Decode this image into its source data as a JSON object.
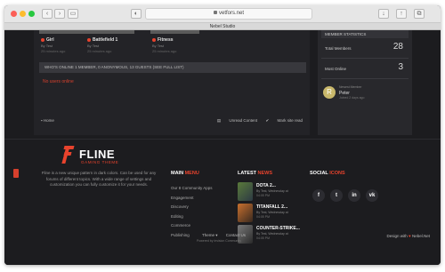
{
  "browser": {
    "url": "vetfors.net",
    "tab_title": "Nebel Studio"
  },
  "cards": [
    {
      "name": "Girl",
      "sub": "By Test",
      "time": "25 minutes ago"
    },
    {
      "name": "Battlefield 1",
      "sub": "By Test",
      "time": "25 minutes ago"
    },
    {
      "name": "Fitness",
      "sub": "By Test",
      "time": "25 minutes ago"
    }
  ],
  "whos_online": "WHO'S ONLINE   1 MEMBER, 0 ANONYMOUS, 13 GUESTS (SEE FULL LIST)",
  "no_users": "No users online",
  "home_link": "Home",
  "bottom_links": [
    "Unread Content",
    "Mark site read"
  ],
  "stats": {
    "header": "MEMBER STATISTICS",
    "rows": [
      {
        "label": "Total Members",
        "value": "28",
        "unit": ""
      },
      {
        "label": "Most Online",
        "value": "3",
        "unit": ""
      }
    ],
    "newest": {
      "label": "Newest Member",
      "name": "Peter",
      "meta": "Joined 2 days ago"
    }
  },
  "brand": {
    "name": "FLINE",
    "tagline": "GAMING THEME",
    "description": "Fline is a new unique pattern in dark colors. Can be used for any forums of different topics. With a wide range of settings and customization you can fully customize it for your needs."
  },
  "menu": {
    "title_white": "MAIN",
    "title_red": "MENU",
    "items": [
      "Our 8 Community Apps",
      "Engagement",
      "Discovery",
      "Editing",
      "Commerce",
      "Publishing"
    ]
  },
  "news": {
    "title_white": "LATEST",
    "title_red": "NEWS",
    "items": [
      {
        "title": "DOTA 2...",
        "by": "By Test, Wednesday at",
        "when": "04:05 PM"
      },
      {
        "title": "TITANFALL 2...",
        "by": "By Test, Wednesday at",
        "when": "04:05 PM"
      },
      {
        "title": "COUNTER-STRIKE...",
        "by": "By Test, Wednesday at",
        "when": "04:05 PM"
      }
    ]
  },
  "social": {
    "title_white": "SOCIAL",
    "title_red": "ICONS",
    "icons": [
      "f",
      "t",
      "in",
      "vk"
    ]
  },
  "footer": {
    "links": [
      "Theme ▾",
      "Contact Us"
    ],
    "powered": "Powered by Invision Community",
    "design_prefix": "Design with",
    "design_heart": "♥",
    "design_suffix": "Nebel.Net"
  },
  "colors": {
    "accent": "#e8432d",
    "background": "#1c1c1f"
  }
}
